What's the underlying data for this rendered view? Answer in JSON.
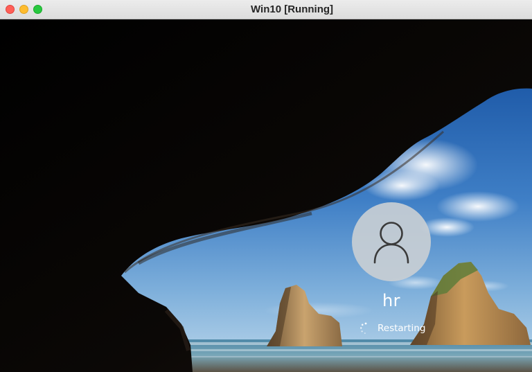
{
  "window": {
    "title": "Win10 [Running]"
  },
  "lock_screen": {
    "user_name": "hr",
    "status_text": "Restarting",
    "user_icon": "user-account-icon",
    "spinner_icon": "loading-spinner-icon"
  },
  "colors": {
    "close": "#ff5f57",
    "minimize": "#febc2e",
    "maximize": "#28c840",
    "avatar_bg": "#c8ced4"
  }
}
